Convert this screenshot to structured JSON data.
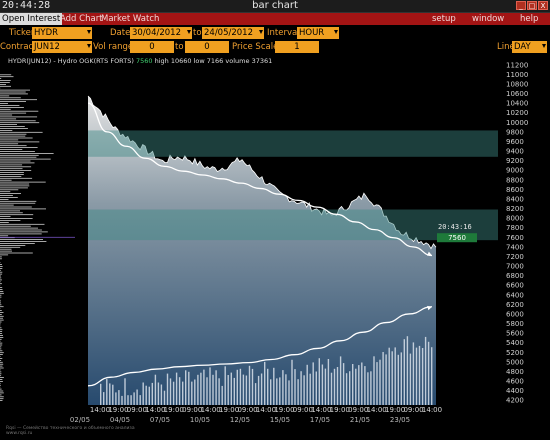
{
  "window": {
    "clock": "20:44:28",
    "title": "bar chart",
    "buttons": [
      "_",
      "□",
      "X"
    ]
  },
  "menu": {
    "left": [
      "Open Interest",
      "Add Chart",
      "Market Watch"
    ],
    "right": [
      "setup",
      "window",
      "help"
    ]
  },
  "controls": {
    "ticker_label": "Ticker",
    "ticker_value": "HYDR",
    "date_label": "Date",
    "date_from": "30/04/2012",
    "to_label": "to",
    "date_to": "24/05/2012",
    "interval_label": "Interval",
    "interval_value": "HOUR",
    "contract_label": "Contract",
    "contract_value": "JUN12",
    "vol_range_label": "Vol range",
    "vol_from": "0",
    "vol_to_label": "to",
    "vol_to": "0",
    "price_scale_label": "Price Scale",
    "price_scale_value": "1",
    "line_label": "Line",
    "line_value": "DAY"
  },
  "info": {
    "instrument": "HYDR(JUN12) - Hydro OGK(RTS FORTS)",
    "last": "7560",
    "high_label": "high",
    "high": "10660",
    "low_label": "low",
    "low": "7166",
    "volume_label": "volume",
    "volume": "37361"
  },
  "chart_data": {
    "type": "bar",
    "instrument": "HYDR(JUN12)",
    "y_ticks": [
      "11200",
      "11000",
      "10800",
      "10600",
      "10400",
      "10200",
      "10000",
      "9800",
      "9600",
      "9400",
      "9200",
      "9000",
      "8800",
      "8600",
      "8400",
      "8200",
      "8000",
      "7800",
      "7600",
      "7400",
      "7200",
      "7000",
      "6800",
      "6600",
      "6400",
      "6200",
      "6000",
      "5800",
      "5600",
      "5400",
      "5200",
      "5000",
      "4800",
      "4600",
      "4400",
      "4200"
    ],
    "ylim": [
      4100,
      11300
    ],
    "x_time_labels": [
      "14:00",
      "19:00",
      "09:00",
      "14:00",
      "19:00",
      "09:00",
      "14:00",
      "19:00",
      "09:00",
      "14:00",
      "19:00",
      "09:00",
      "14:00",
      "19:00",
      "09:00",
      "14:00",
      "19:00",
      "09:00",
      "14:00"
    ],
    "x_date_labels": [
      "02/05",
      "04/05",
      "07/05",
      "10/05",
      "12/05",
      "15/05",
      "17/05",
      "21/05",
      "23/05"
    ],
    "cursor_time": "20:43:16",
    "cursor_price": "7560",
    "price_bands": [
      [
        9280,
        9830
      ],
      [
        7540,
        8180
      ]
    ],
    "price_trend": [
      [
        10400,
        9800,
        9500,
        9250,
        9080,
        8980,
        8900,
        8820,
        8730,
        8620,
        8500,
        8370,
        8230,
        8080,
        7920,
        7760,
        7590,
        7400,
        7220
      ]
    ],
    "volume_trend": [
      4500,
      4680,
      4780,
      4850,
      4900,
      4930,
      4955,
      4985,
      5050,
      5150,
      5280,
      5440,
      5620,
      5820,
      6000,
      6150
    ]
  },
  "footer": {
    "line1": "Rqsi — Семейство технического и объемного анализа",
    "line2": "www.rqsi.ru"
  }
}
